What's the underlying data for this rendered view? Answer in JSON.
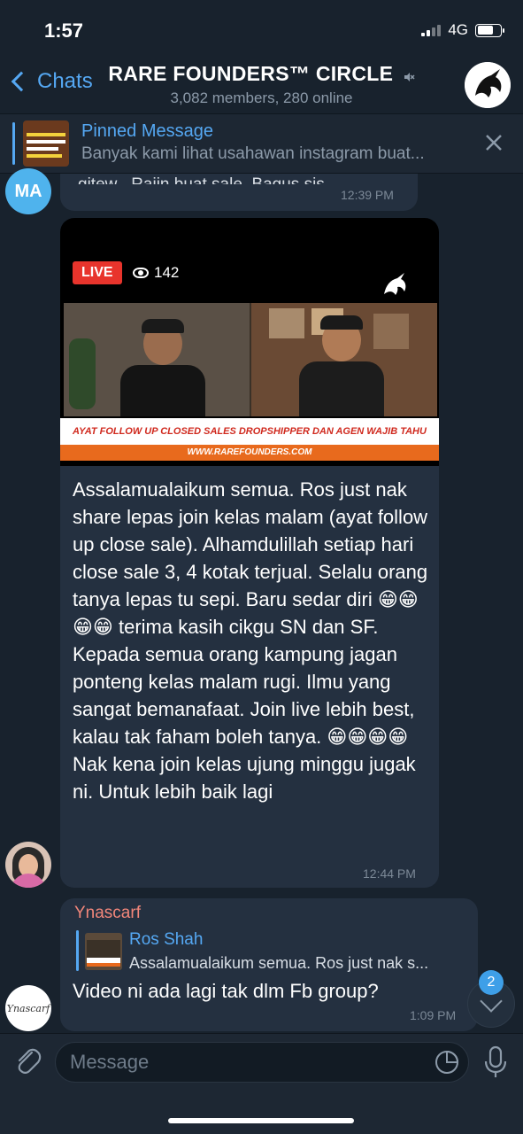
{
  "status_bar": {
    "time": "1:57",
    "network": "4G"
  },
  "header": {
    "back_label": "Chats",
    "title": "RARE FOUNDERS™ CIRCLE",
    "subtitle": "3,082 members, 280 online"
  },
  "pinned": {
    "label": "Pinned Message",
    "text": "Banyak kami lihat usahawan instagram buat..."
  },
  "messages": {
    "previous": {
      "avatar_initials": "MA",
      "text": "gitew . Rajin buat sale. Bagus sis",
      "time": "12:39 PM"
    },
    "main": {
      "video": {
        "live_label": "LIVE",
        "views": "142",
        "caption": "AYAT FOLLOW UP CLOSED SALES DROPSHIPPER DAN AGEN WAJIB TAHU",
        "url": "WWW.RAREFOUNDERS.COM"
      },
      "text": "Assalamualaikum semua. Ros just nak share lepas join kelas malam (ayat follow up close sale). Alhamdulillah setiap hari close sale 3, 4 kotak terjual. Selalu orang tanya lepas tu sepi. Baru sedar diri 😁😁 😁😁 terima kasih cikgu SN dan SF. Kepada semua orang kampung jagan ponteng kelas malam rugi. Ilmu yang sangat bemanafaat. Join live lebih best, kalau tak faham boleh tanya. 😁😁😁😁\nNak kena join kelas ujung minggu jugak ni. Untuk lebih baik lagi",
      "time": "12:44 PM"
    },
    "reply": {
      "author": "Ynascarf",
      "quote_name": "Ros Shah",
      "quote_text": "Assalamualaikum semua. Ros just nak s...",
      "text": "Video ni ada lagi tak dlm Fb group?",
      "time": "1:09 PM",
      "avatar_text": "Ynascarf"
    }
  },
  "scroll": {
    "unread_count": "2"
  },
  "composer": {
    "placeholder": "Message"
  },
  "colors": {
    "accent": "#55a8f3",
    "background": "#18222d",
    "bubble": "#243040",
    "author": "#f2867a"
  },
  "icons": [
    "chevron-left-icon",
    "mute-icon",
    "close-icon",
    "eye-icon",
    "chevron-down-icon",
    "paperclip-icon",
    "sticker-icon",
    "microphone-icon"
  ]
}
